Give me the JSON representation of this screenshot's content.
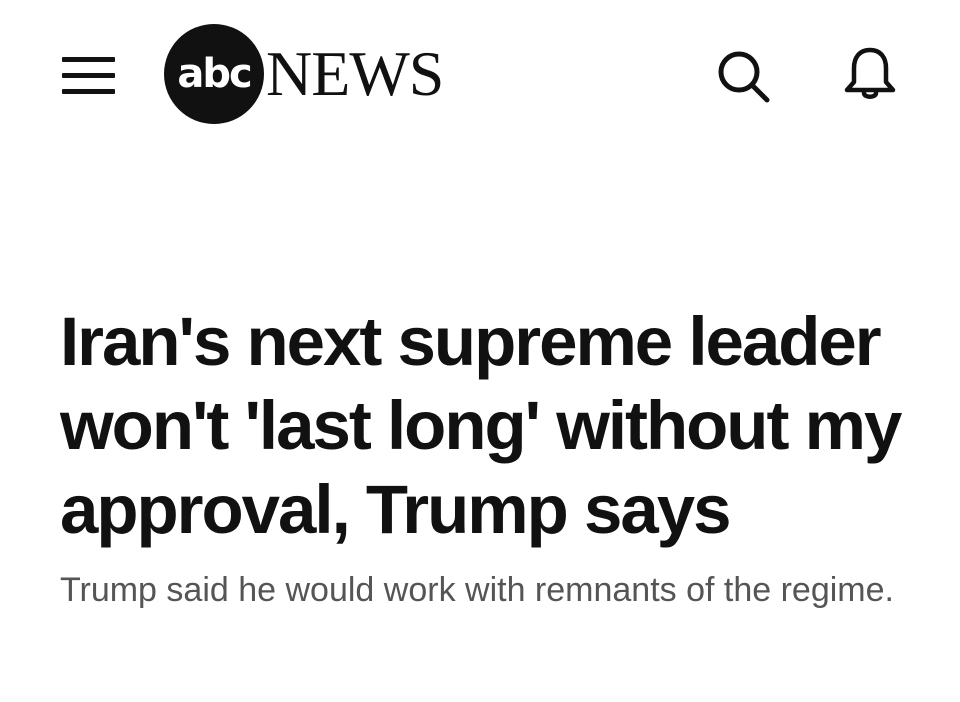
{
  "header": {
    "menu_icon": "hamburger-menu-icon",
    "logo": {
      "circle_text": "abc",
      "wordmark": "NEWS"
    },
    "search_icon": "search-icon",
    "notifications_icon": "bell-icon"
  },
  "article": {
    "headline": "Iran's next supreme leader won't 'last long' without my approval, Trump says",
    "subheadline": "Trump said he would work with remnants of the regime."
  },
  "colors": {
    "text": "#111111",
    "subtext": "#555555",
    "background": "#ffffff"
  }
}
